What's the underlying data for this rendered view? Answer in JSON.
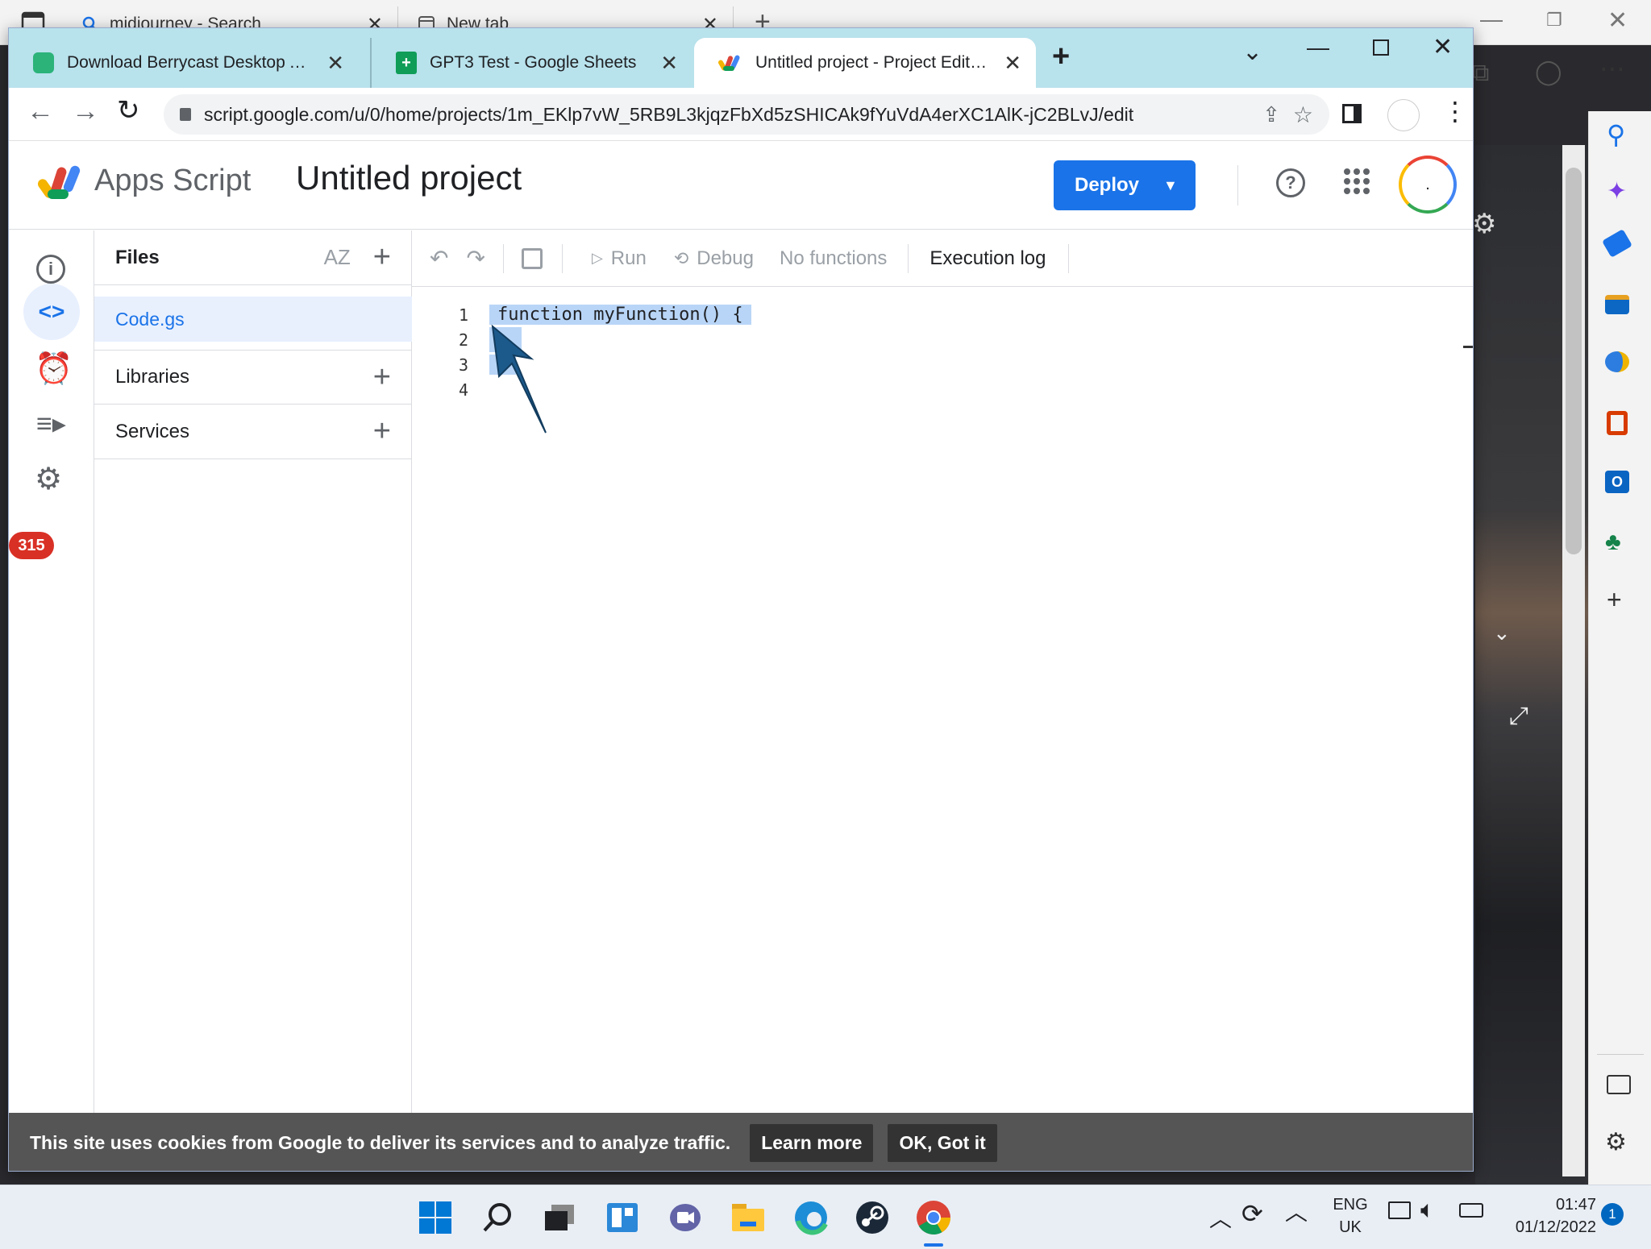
{
  "background_browser": {
    "tabs": [
      {
        "label": "midjourney - Search"
      },
      {
        "label": "New tab"
      }
    ]
  },
  "chrome": {
    "tabs": [
      {
        "label": "Download Berrycast Desktop App",
        "icon": "berrycast-icon"
      },
      {
        "label": "GPT3 Test - Google Sheets",
        "icon": "sheets-icon"
      },
      {
        "label": "Untitled project - Project Editor - Apps Script",
        "icon": "apps-script-icon"
      }
    ],
    "url": "script.google.com/u/0/home/projects/1m_EKlp7vW_5RB9L3kjqzFbXd5zSHICAk9fYuVdA4erXC1AlK-jC2BLvJ/edit"
  },
  "header": {
    "app_name": "Apps Script",
    "project_title": "Untitled project",
    "deploy_label": "Deploy",
    "avatar_initial": "."
  },
  "rail": {
    "badge_count": "315"
  },
  "files_panel": {
    "title": "Files",
    "sort_label": "AZ",
    "active_file": "Code.gs",
    "libraries_label": "Libraries",
    "services_label": "Services"
  },
  "editor_toolbar": {
    "run_label": "Run",
    "debug_label": "Debug",
    "functions_label": "No functions",
    "execution_log_label": "Execution log"
  },
  "code": {
    "lines": [
      {
        "num": "1",
        "text": "function myFunction() {"
      },
      {
        "num": "2",
        "text": ""
      },
      {
        "num": "3",
        "text": "}"
      },
      {
        "num": "4",
        "text": ""
      }
    ]
  },
  "cookie_bar": {
    "message": "This site uses cookies from Google to deliver its services and to analyze traffic.",
    "learn_more": "Learn more",
    "ok_label": "OK, Got it"
  },
  "taskbar": {
    "lang_1": "ENG",
    "lang_2": "UK",
    "time": "01:47",
    "date": "01/12/2022",
    "notification_count": "1"
  },
  "colors": {
    "accent": "#1a73e8",
    "tabstrip": "#b8e2ec",
    "badge": "#d93025",
    "selection": "#b8d5f7"
  }
}
